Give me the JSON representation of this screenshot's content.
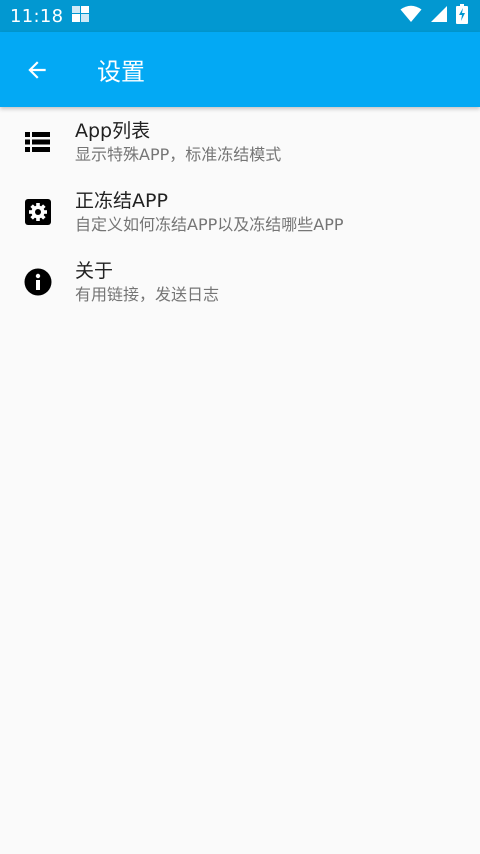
{
  "status_bar": {
    "time": "11:18"
  },
  "app_bar": {
    "title": "设置"
  },
  "settings": {
    "items": [
      {
        "icon": "list-icon",
        "title": "App列表",
        "subtitle": "显示特殊APP，标准冻结模式"
      },
      {
        "icon": "gear-icon",
        "title": "正冻结APP",
        "subtitle": "自定义如何冻结APP以及冻结哪些APP"
      },
      {
        "icon": "info-icon",
        "title": "关于",
        "subtitle": "有用链接，发送日志"
      }
    ]
  },
  "colors": {
    "status_bar": "#0298d1",
    "app_bar": "#03a9f4",
    "background": "#fafafa",
    "title_text": "#212121",
    "subtitle_text": "#757575"
  }
}
